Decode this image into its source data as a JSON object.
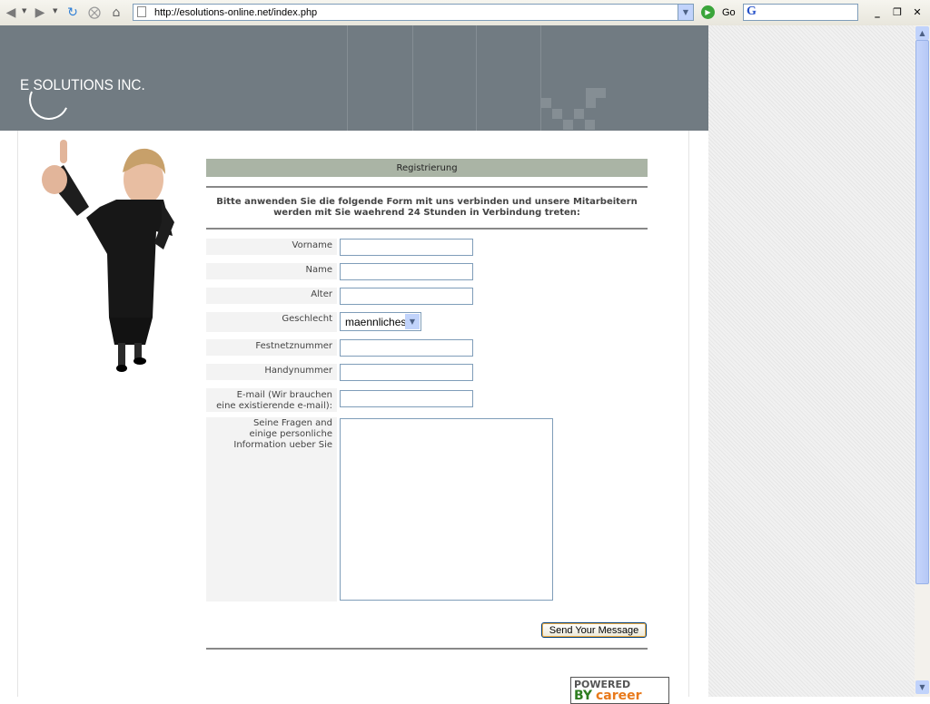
{
  "browser": {
    "address": "http://esolutions-online.net/index.php",
    "go_label": "Go"
  },
  "header": {
    "logo_text": "E SOLUTIONS INC."
  },
  "form": {
    "title": "Registrierung",
    "intro": "Bitte anwenden Sie die folgende Form mit uns verbinden und unsere Mitarbeitern werden mit Sie waehrend 24 Stunden in Verbindung treten:",
    "fields": {
      "vorname": "Vorname",
      "name": "Name",
      "alter": "Alter",
      "geschlecht": "Geschlecht",
      "festnetz": "Festnetznummer",
      "handy": "Handynummer",
      "email": "E-mail (Wir brauchen eine existierende e-mail):",
      "fragen": "Seine Fragen and einige personliche Information ueber Sie"
    },
    "geschlecht_value": "maennliches",
    "submit_label": "Send Your Message"
  },
  "badge": {
    "line1": "POWERED",
    "line2a": "BY",
    "line2b": "career"
  },
  "colors": {
    "header_bg": "#717b82",
    "title_bar": "#aab4a5"
  }
}
